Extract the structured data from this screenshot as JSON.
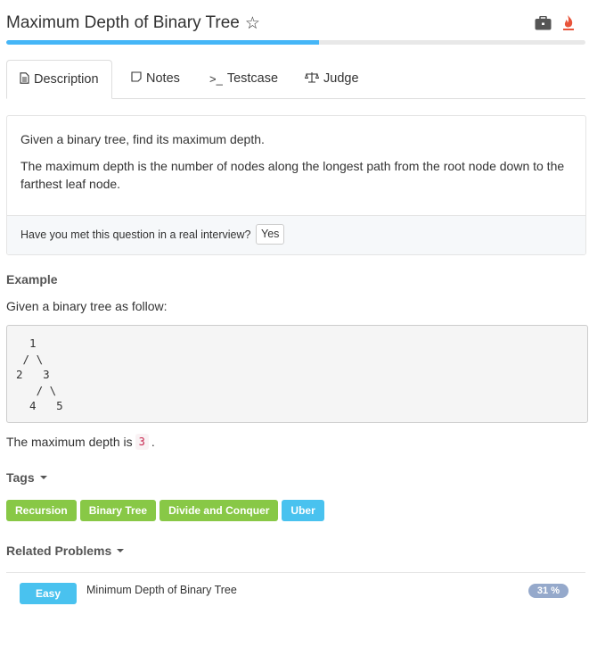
{
  "header": {
    "title": "Maximum Depth of Binary Tree",
    "progress_percent": 54
  },
  "tabs": [
    {
      "label": "Description",
      "icon": "document-icon",
      "active": true
    },
    {
      "label": "Notes",
      "icon": "note-icon",
      "active": false
    },
    {
      "label": "Testcase",
      "icon": "terminal-icon",
      "active": false
    },
    {
      "label": "Judge",
      "icon": "scale-icon",
      "active": false
    }
  ],
  "description": {
    "p1": "Given a binary tree, find its maximum depth.",
    "p2": "The maximum depth is the number of nodes along the longest path from the root node down to the farthest leaf node.",
    "interview_question": "Have you met this question in a real interview?",
    "yes_label": "Yes"
  },
  "example": {
    "heading": "Example",
    "intro": "Given a binary tree as follow:",
    "code": "  1\n / \\\n2   3\n   / \\\n  4   5",
    "depth_prefix": "The maximum depth is",
    "depth_value": "3",
    "depth_suffix": "."
  },
  "tags": {
    "heading": "Tags",
    "items": [
      {
        "label": "Recursion",
        "color": "#88c846"
      },
      {
        "label": "Binary Tree",
        "color": "#88c846"
      },
      {
        "label": "Divide and Conquer",
        "color": "#88c846"
      },
      {
        "label": "Uber",
        "color": "#49c2ef"
      }
    ]
  },
  "related": {
    "heading": "Related Problems",
    "items": [
      {
        "difficulty": "Easy",
        "title": "Minimum Depth of Binary Tree",
        "rate": "31 %"
      }
    ]
  },
  "colors": {
    "accent": "#45b6f7",
    "green": "#88c846",
    "blue": "#49c2ef",
    "fire": "#e8543a"
  }
}
